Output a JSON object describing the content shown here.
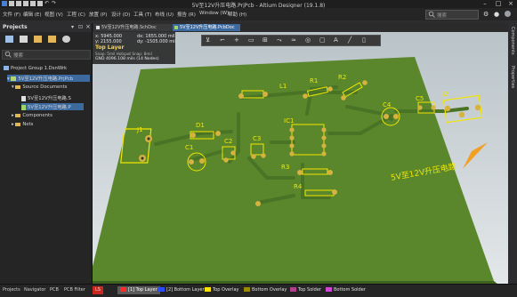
{
  "window": {
    "title": "5V至12V升压电路.PrjPcb - Altium Designer (19.1.8)"
  },
  "menu": {
    "items": [
      "文件 (F)",
      "编辑 (E)",
      "视图 (V)",
      "工程 (C)",
      "放置 (P)",
      "设计 (D)",
      "工具 (T)",
      "布线 (U)",
      "报告 (R)",
      "Window (W)",
      "帮助 (H)"
    ]
  },
  "search": {
    "placeholder": "搜索"
  },
  "projects_panel": {
    "title": "Projects",
    "search_placeholder": "搜索",
    "tree": {
      "group": "Project Group 1.DsnWrk",
      "project": "5V至12V升压电路.PrjPcb",
      "source_docs": "Source Documents",
      "doc_sch": "5V至12V升压电路.S",
      "doc_pcb": "5V至12V升压电路.P",
      "components": "Components",
      "nets": "Nets"
    }
  },
  "doc_tabs": {
    "sch": "5V至12V升压电路.SchDoc",
    "pcb": "5V至12V升压电路.PcbDoc"
  },
  "hud": {
    "x": "x: 5945.000",
    "dx": "dx: 1655.000 mil",
    "y": "y: 2155.000",
    "dy": "dy: -1505.000 mil",
    "layer": "Top Layer",
    "snap": "Snap: 5mil Hotspot Snap: 8mil",
    "gnd": "GND  4096.108 mils (14 Nodes)"
  },
  "pcb": {
    "designators": [
      "L1",
      "R1",
      "R2",
      "C4",
      "C5",
      "J2",
      "J1",
      "D1",
      "C1",
      "C2",
      "C3",
      "IC1",
      "R3",
      "R4"
    ],
    "board_text": "5V至12V升压电路"
  },
  "right_panel": {
    "tabs": [
      "Components",
      "Properties"
    ]
  },
  "bottom_tabs": [
    "Projects",
    "Navigator",
    "PCB",
    "PCB Filter"
  ],
  "layers": [
    {
      "label": "LS",
      "color": "#c8281e"
    },
    {
      "label": "[1] Top Layer",
      "color": "#ff2b2b"
    },
    {
      "label": "[2] Bottom Layer",
      "color": "#2b4bff"
    },
    {
      "label": "Top Overlay",
      "color": "#ffe400"
    },
    {
      "label": "Bottom Overlay",
      "color": "#9a8a00"
    },
    {
      "label": "Top Solder",
      "color": "#b33f8f"
    },
    {
      "label": "Bottom Solder",
      "color": "#d245d8"
    }
  ],
  "colors": {
    "board": "#5d8a2e",
    "silkscreen": "#f2e600",
    "pad": "#d6b240",
    "trace": "#4a7425"
  }
}
